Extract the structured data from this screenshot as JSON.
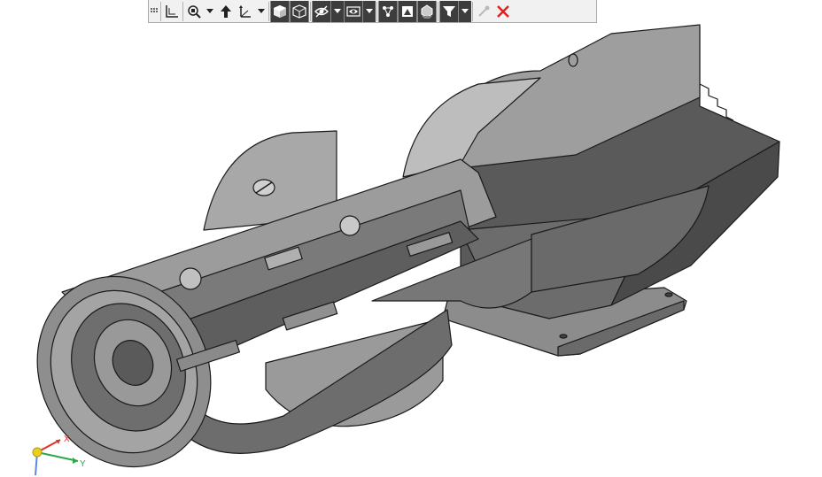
{
  "toolbar": {
    "buttons": [
      {
        "name": "toolbar-grip",
        "icon": "grip-icon"
      },
      {
        "name": "view-orientation-button",
        "icon": "view-orientation-icon"
      },
      {
        "name": "zoom-to-area-button",
        "icon": "zoom-area-icon"
      },
      {
        "name": "previous-view-button",
        "icon": "previous-view-icon"
      },
      {
        "name": "section-view-button",
        "icon": "section-view-icon"
      },
      {
        "name": "view-orientation-dropdown",
        "icon": "triad-view-icon"
      },
      {
        "name": "display-style-shaded-button",
        "icon": "shaded-cube-icon"
      },
      {
        "name": "display-style-wireframe-button",
        "icon": "wireframe-cube-icon"
      },
      {
        "name": "hide-show-items-button",
        "icon": "eye-hide-icon"
      },
      {
        "name": "edit-appearance-button",
        "icon": "appearance-icon"
      },
      {
        "name": "apply-scene-button",
        "icon": "scene-icon"
      },
      {
        "name": "view-settings-button",
        "icon": "view-settings-icon"
      },
      {
        "name": "shadows-button",
        "icon": "shadows-icon"
      },
      {
        "name": "filter-button",
        "icon": "filter-icon"
      },
      {
        "name": "eyedropper-button",
        "icon": "eyedropper-icon"
      },
      {
        "name": "close-button",
        "icon": "close-icon"
      }
    ]
  },
  "triad": {
    "x_label": "X",
    "y_label": "Y"
  },
  "colors": {
    "model_light": "#9a9a9a",
    "model_mid": "#7c7c7c",
    "model_dark": "#5a5a5a",
    "model_edge": "#1a1a1a",
    "axis_x": "#e0302a",
    "axis_y": "#2aa84a",
    "axis_z": "#e8d020",
    "close_red": "#e02020"
  }
}
